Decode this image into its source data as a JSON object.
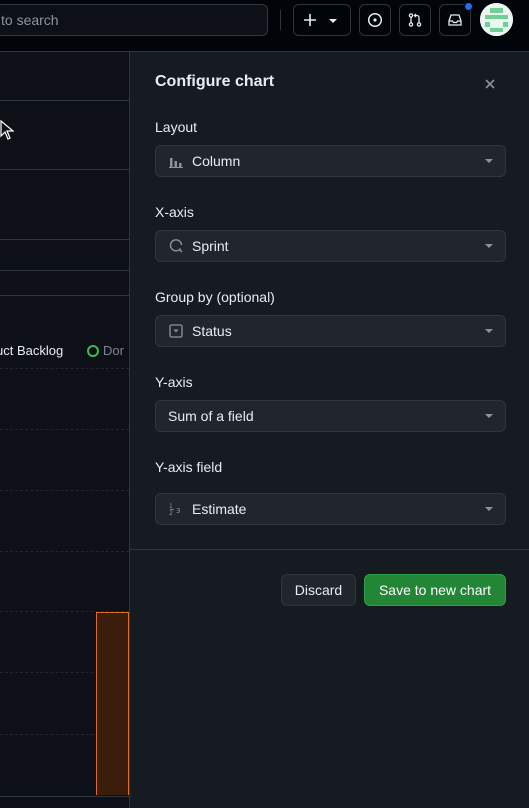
{
  "header": {
    "search_placeholder": "to search",
    "icons": [
      "plus-icon",
      "chevron-down-icon",
      "issue-icon",
      "pull-request-icon",
      "inbox-icon",
      "avatar"
    ]
  },
  "background": {
    "legend_product_backlog": "uct Backlog",
    "legend_done": "Dor"
  },
  "panel": {
    "title": "Configure chart",
    "fields": [
      {
        "label": "Layout",
        "value": "Column",
        "icon": "column-chart-icon"
      },
      {
        "label": "X-axis",
        "value": "Sprint",
        "icon": "iteration-icon"
      },
      {
        "label": "Group by (optional)",
        "value": "Status",
        "icon": "single-select-icon"
      },
      {
        "label": "Y-axis",
        "value": "Sum of a field",
        "icon": ""
      },
      {
        "label": "Y-axis field",
        "value": "Estimate",
        "icon": "number-icon"
      }
    ],
    "discard_label": "Discard",
    "save_label": "Save to new chart"
  },
  "colors": {
    "accent_green": "#238636",
    "bar_orange": "#db6d28",
    "status_done": "#3fb950",
    "notification_blue": "#1f6feb"
  }
}
